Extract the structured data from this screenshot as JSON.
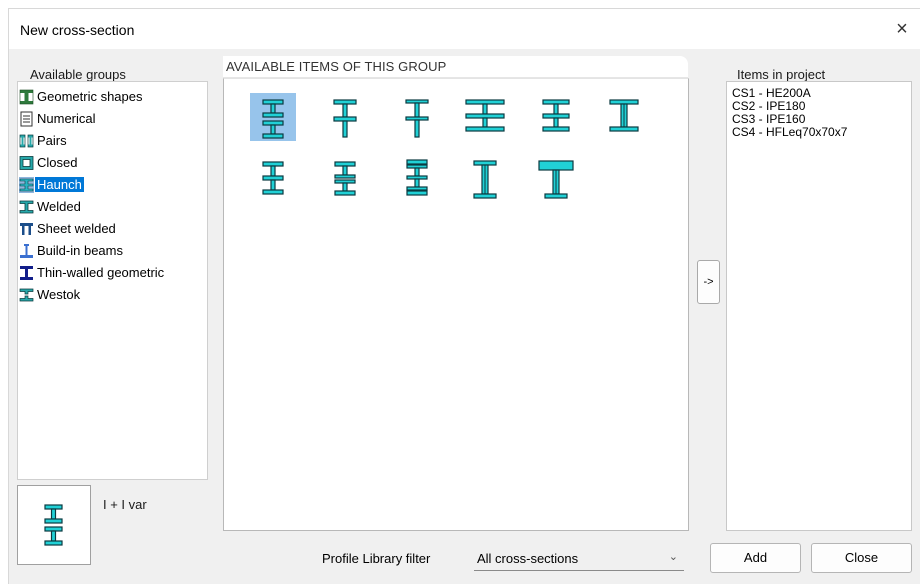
{
  "dialog": {
    "title": "New cross-section",
    "close_glyph": "×"
  },
  "groups_panel": {
    "label": "Available groups",
    "items": [
      {
        "label": "Geometric shapes",
        "icon": "geometric-shapes-icon",
        "selected": false
      },
      {
        "label": "Numerical",
        "icon": "numerical-icon",
        "selected": false
      },
      {
        "label": "Pairs",
        "icon": "pairs-icon",
        "selected": false
      },
      {
        "label": "Closed",
        "icon": "closed-icon",
        "selected": false
      },
      {
        "label": "Haunch",
        "icon": "haunch-icon",
        "selected": true
      },
      {
        "label": "Welded",
        "icon": "welded-icon",
        "selected": false
      },
      {
        "label": "Sheet welded",
        "icon": "sheet-welded-icon",
        "selected": false
      },
      {
        "label": "Build-in beams",
        "icon": "build-in-beams-icon",
        "selected": false
      },
      {
        "label": "Thin-walled geometric",
        "icon": "thin-walled-geometric-icon",
        "selected": false
      },
      {
        "label": "Westok",
        "icon": "westok-icon",
        "selected": false
      }
    ]
  },
  "preview": {
    "label": "I + I var",
    "icon": "i-plus-i-var-icon"
  },
  "items_panel": {
    "label": "AVAILABLE ITEMS OF THIS GROUP",
    "items": [
      {
        "icon": "haunch-profile-1-icon",
        "selected": true
      },
      {
        "icon": "haunch-profile-2-icon",
        "selected": false
      },
      {
        "icon": "haunch-profile-3-icon",
        "selected": false
      },
      {
        "icon": "haunch-profile-4-icon",
        "selected": false
      },
      {
        "icon": "haunch-profile-5-icon",
        "selected": false
      },
      {
        "icon": "haunch-profile-6-icon",
        "selected": false
      },
      {
        "icon": "haunch-profile-7-icon",
        "selected": false
      },
      {
        "icon": "haunch-profile-8-icon",
        "selected": false
      },
      {
        "icon": "haunch-profile-9-icon",
        "selected": false
      },
      {
        "icon": "haunch-profile-10-icon",
        "selected": false
      },
      {
        "icon": "haunch-profile-11-icon",
        "selected": false
      }
    ]
  },
  "transfer_button": {
    "label": "->"
  },
  "project_panel": {
    "label": "Items in project",
    "items": [
      "CS1 - HE200A",
      "CS2 - IPE180",
      "CS3 - IPE160",
      "CS4 - HFLeq70x70x7"
    ]
  },
  "filter": {
    "label": "Profile Library filter",
    "value": "All cross-sections",
    "chevron": "⌄"
  },
  "buttons": {
    "add": "Add",
    "close": "Close"
  },
  "colors": {
    "profile_fill": "#21d1d6",
    "profile_stroke": "#0a3a40",
    "selection": "#0078d7",
    "item_selection": "#97c4eb"
  }
}
